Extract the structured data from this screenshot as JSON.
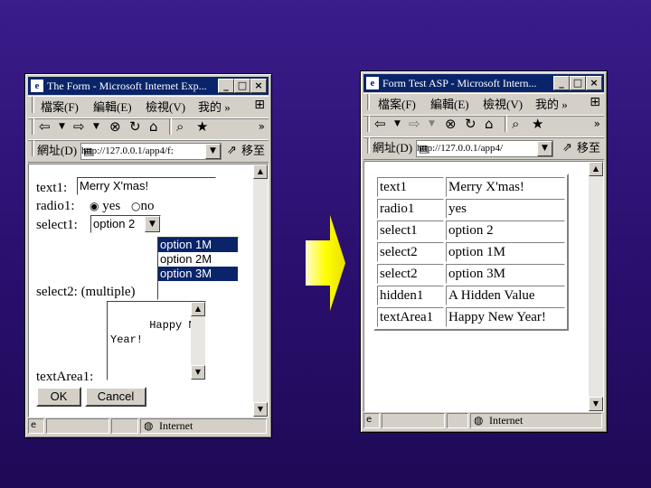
{
  "left_window": {
    "title": "The Form - Microsoft Internet Exp...",
    "title_buttons": [
      "_",
      "□",
      "×"
    ],
    "menu": [
      "檔案(F)",
      "編輯(E)",
      "檢視(V)",
      "我的 »"
    ],
    "address_label": "網址(D)",
    "address_value": "http://127.0.0.1/app4/f:",
    "go_label": "移至",
    "form": {
      "text1_label": "text1:",
      "text1_value": "Merry X'mas!",
      "radio1_label": "radio1:",
      "radio_yes": "yes",
      "radio_no": "no",
      "select1_label": "select1:",
      "select1_value": "option 2",
      "select2_label": "select2: (multiple)",
      "select2_options": [
        "option 1M",
        "option 2M",
        "option 3M"
      ],
      "textarea_label": "textArea1:",
      "textarea_value": "Happy New\nYear!",
      "ok_label": "OK",
      "cancel_label": "Cancel"
    },
    "status_zone": "Internet"
  },
  "right_window": {
    "title": "Form Test ASP - Microsoft Intern...",
    "title_buttons": [
      "_",
      "□",
      "×"
    ],
    "menu": [
      "檔案(F)",
      "編輯(E)",
      "檢視(V)",
      "我的 »"
    ],
    "address_label": "網址(D)",
    "address_value": "http://127.0.0.1/app4/",
    "go_label": "移至",
    "results": [
      [
        "text1",
        "Merry X'mas!"
      ],
      [
        "radio1",
        "yes"
      ],
      [
        "select1",
        "option 2"
      ],
      [
        "select2",
        "option 1M"
      ],
      [
        "select2",
        "option 3M"
      ],
      [
        "hidden1",
        "A Hidden Value"
      ],
      [
        "textArea1",
        "Happy New Year!"
      ]
    ],
    "status_zone": "Internet"
  },
  "colors": {
    "background": "#2a0f6e",
    "arrow": "#ffff00",
    "titlebar": "#0a246a",
    "selection": "#0a246a"
  },
  "arrow_icon": "right-arrow"
}
